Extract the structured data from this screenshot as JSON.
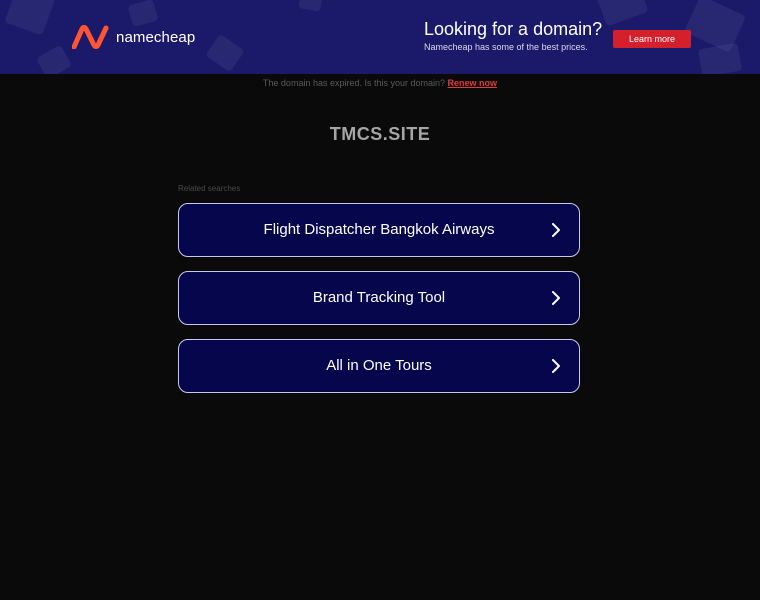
{
  "banner": {
    "brand": "namecheap",
    "promo_title": "Looking for a domain?",
    "promo_subtitle": "Namecheap has some of the best prices.",
    "cta_label": "Learn more",
    "colors": {
      "background": "#1b1a6a",
      "accent": "#d4202c",
      "logo": "#ff5533"
    }
  },
  "notice": {
    "text": "The domain has expired. Is this your domain?",
    "link_label": "Renew now"
  },
  "site_title": "TMCS.SITE",
  "related": {
    "heading": "Related searches",
    "items": [
      {
        "label": "Flight Dispatcher Bangkok Airways",
        "icon": "chevron-right-icon"
      },
      {
        "label": "Brand Tracking Tool",
        "icon": "chevron-right-icon"
      },
      {
        "label": "All in One Tours",
        "icon": "chevron-right-icon"
      }
    ]
  }
}
